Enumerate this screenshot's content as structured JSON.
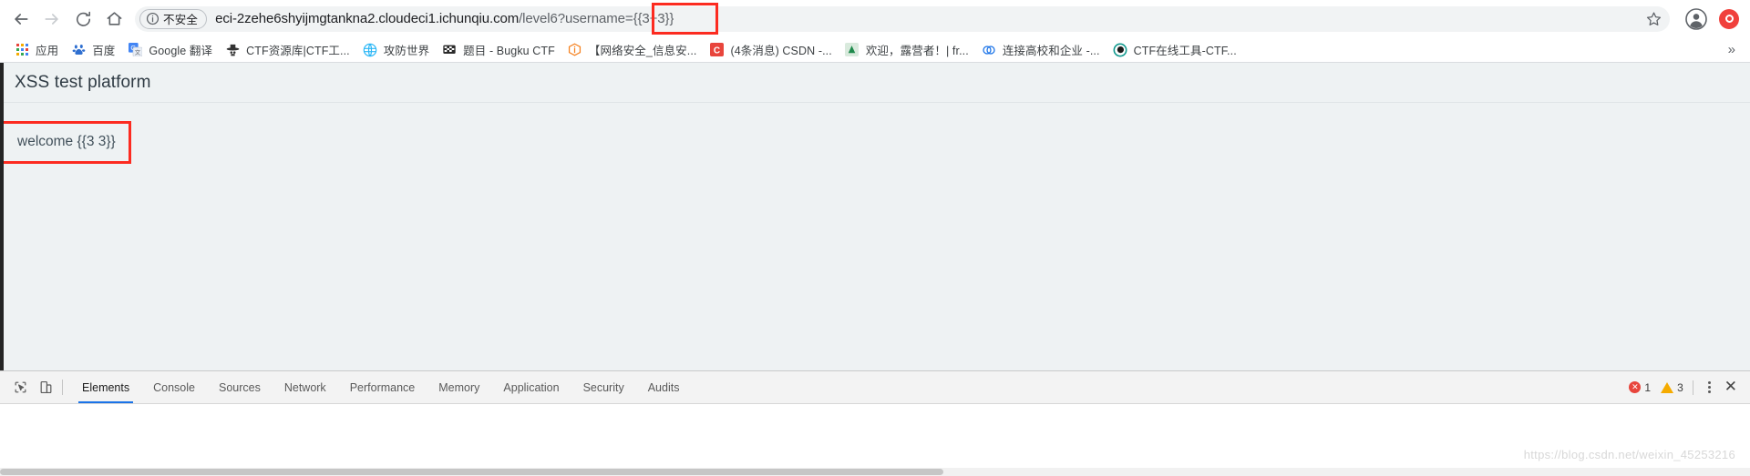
{
  "browser": {
    "nav": {
      "back_label": "Back",
      "forward_label": "Forward",
      "reload_label": "Reload",
      "home_label": "Home"
    },
    "omnibox": {
      "security_label": "不安全",
      "security_icon": "info-circle-icon",
      "url_host": "eci-2zehe6shyijmgtankna2.cloudeci1.ichunqiu.com",
      "url_path": "/level6?username=",
      "url_payload": "{{3+3}}",
      "full_url": "eci-2zehe6shyijmgtankna2.cloudeci1.ichunqiu.com/level6?username={{3+3}}",
      "star_icon": "bookmark-star-icon",
      "profile_icon": "account-avatar-icon",
      "extension_icon": "extension-icon"
    },
    "bookmarks": {
      "apps_label": "应用",
      "overflow_label": "»",
      "items": [
        {
          "label": "百度",
          "icon": "baidu-paw-icon",
          "color": "#2f6fd0"
        },
        {
          "label": "Google 翻译",
          "icon": "google-translate-icon",
          "color": "#1a73e8"
        },
        {
          "label": "CTF资源库|CTF工...",
          "icon": "detective-hat-icon",
          "color": "#333333"
        },
        {
          "label": "攻防世界",
          "icon": "xctf-globe-icon",
          "color": "#29b6f6"
        },
        {
          "label": "题目 - Bugku CTF",
          "icon": "checkered-flag-icon",
          "color": "#2b2b2b"
        },
        {
          "label": "【网络安全_信息安...",
          "icon": "ichunqiu-icon",
          "color": "#f5811f"
        },
        {
          "label": "(4条消息) CSDN -...",
          "icon": "csdn-icon",
          "color": "#e8453c"
        },
        {
          "label": "欢迎，露营者！| fr...",
          "icon": "camper-icon",
          "color": "#1f8a4c"
        },
        {
          "label": "连接高校和企业 -...",
          "icon": "link-rings-icon",
          "color": "#1a73e8"
        },
        {
          "label": "CTF在线工具-CTF...",
          "icon": "ctf-tools-icon",
          "color": "#11998e"
        }
      ]
    }
  },
  "page": {
    "title": "XSS test platform",
    "welcome_text": "welcome {{3 3}}",
    "annotation_color": "#fc2b20"
  },
  "devtools": {
    "inspect_icon": "inspect-element-icon",
    "device_icon": "device-toolbar-icon",
    "tabs": [
      {
        "label": "Elements",
        "active": true
      },
      {
        "label": "Console",
        "active": false
      },
      {
        "label": "Sources",
        "active": false
      },
      {
        "label": "Network",
        "active": false
      },
      {
        "label": "Performance",
        "active": false
      },
      {
        "label": "Memory",
        "active": false
      },
      {
        "label": "Application",
        "active": false
      },
      {
        "label": "Security",
        "active": false
      },
      {
        "label": "Audits",
        "active": false
      }
    ],
    "error_count": "1",
    "warning_count": "3",
    "more_icon": "kebab-menu-icon",
    "close_icon": "close-icon",
    "accent_color": "#1a73e8",
    "error_color": "#e8453c",
    "warning_color": "#f5ab00"
  },
  "watermark": "https://blog.csdn.net/weixin_45253216"
}
